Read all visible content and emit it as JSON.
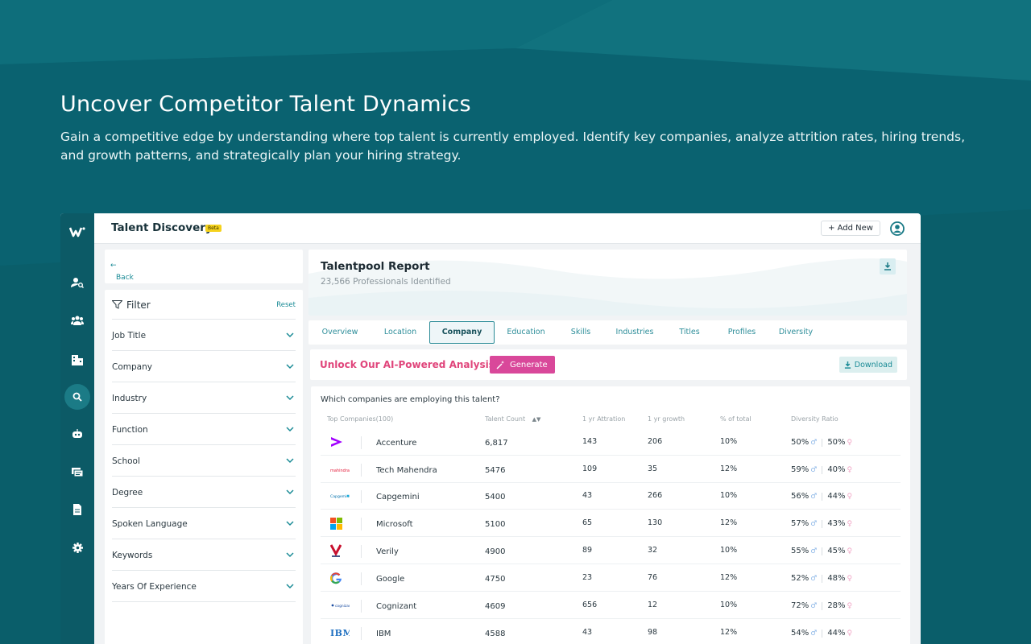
{
  "hero": {
    "title": "Uncover Competitor Talent Dynamics",
    "subtitle": "Gain a competitive edge by understanding where top talent is currently employed. Identify key companies, analyze attrition rates, hiring trends, and growth patterns, and strategically plan your hiring strategy."
  },
  "topbar": {
    "title": "Talent Discovery",
    "badge": "Beta",
    "add_new": "+ Add New"
  },
  "sidebar_icons": [
    "candidate-search-icon",
    "team-icon",
    "company-icon",
    "discovery-icon",
    "bot-icon",
    "jobs-icon",
    "document-icon",
    "settings-icon"
  ],
  "back_label": "Back",
  "filter": {
    "title": "Filter",
    "reset": "Reset",
    "items": [
      "Job Title",
      "Company",
      "Industry",
      "Function",
      "School",
      "Degree",
      "Spoken Language",
      "Keywords",
      "Years Of Experience"
    ]
  },
  "report": {
    "title": "Talentpool Report",
    "subtitle": "23,566 Professionals Identified"
  },
  "tabs": [
    "Overview",
    "Location",
    "Company",
    "Education",
    "Skills",
    "Industries",
    "Titles",
    "Profiles",
    "Diversity"
  ],
  "active_tab": "Company",
  "unlock": {
    "text": "Unlock Our AI-Powered Analysis!",
    "generate": "Generate",
    "download": "Download"
  },
  "table": {
    "question": "Which companies are employing this talent?",
    "headers": [
      "Top Companies(100)",
      "Talent Count",
      "1 yr Attration",
      "1 yr growth",
      "% of total",
      "Diversity Ratio"
    ],
    "rows": [
      {
        "company": "Accenture",
        "count": "6,817",
        "attrition": "143",
        "growth": "206",
        "pct": "10%",
        "male": "50%",
        "female": "50%"
      },
      {
        "company": "Tech Mahendra",
        "count": "5476",
        "attrition": "109",
        "growth": "35",
        "pct": "12%",
        "male": "59%",
        "female": "40%"
      },
      {
        "company": "Capgemini",
        "count": "5400",
        "attrition": "43",
        "growth": "266",
        "pct": "10%",
        "male": "56%",
        "female": "44%"
      },
      {
        "company": "Microsoft",
        "count": "5100",
        "attrition": "65",
        "growth": "130",
        "pct": "12%",
        "male": "57%",
        "female": "43%"
      },
      {
        "company": "Verily",
        "count": "4900",
        "attrition": "89",
        "growth": "32",
        "pct": "10%",
        "male": "55%",
        "female": "45%"
      },
      {
        "company": "Google",
        "count": "4750",
        "attrition": "23",
        "growth": "76",
        "pct": "12%",
        "male": "52%",
        "female": "48%"
      },
      {
        "company": "Cognizant",
        "count": "4609",
        "attrition": "656",
        "growth": "12",
        "pct": "10%",
        "male": "72%",
        "female": "28%"
      },
      {
        "company": "IBM",
        "count": "4588",
        "attrition": "43",
        "growth": "98",
        "pct": "12%",
        "male": "54%",
        "female": "44%"
      }
    ]
  },
  "logo_text": {
    "tech_mahindra": "mahindra",
    "capgemini": "Capgemini",
    "cognizant": "cognizant",
    "ibm": "IBM"
  },
  "colors": {
    "background": "#0b6572",
    "accent": "#1a8b96",
    "ai_pink": "#e0457b",
    "generate": "#d9489a"
  }
}
